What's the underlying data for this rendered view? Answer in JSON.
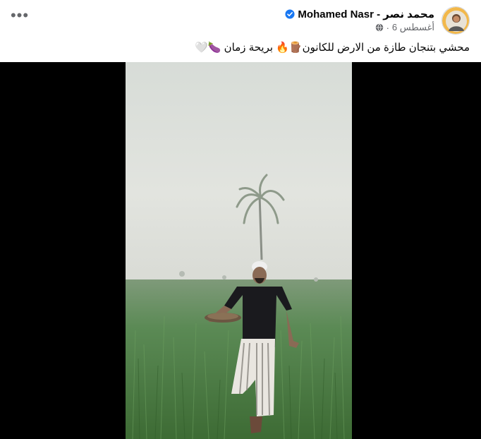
{
  "post": {
    "author_name": "Mohamed Nasr - محمد نصر",
    "date": "6 أغسطس",
    "separator": "·",
    "caption": "محشي بتنجان طازة من الارض  للكانون🪵🔥 بريحة زمان 🍆🤍"
  },
  "icons": {
    "more": "more-options-icon",
    "verified": "verified-badge-icon",
    "audience": "globe-icon"
  },
  "colors": {
    "verified_blue": "#1877f2",
    "secondary_text": "#65676b"
  }
}
